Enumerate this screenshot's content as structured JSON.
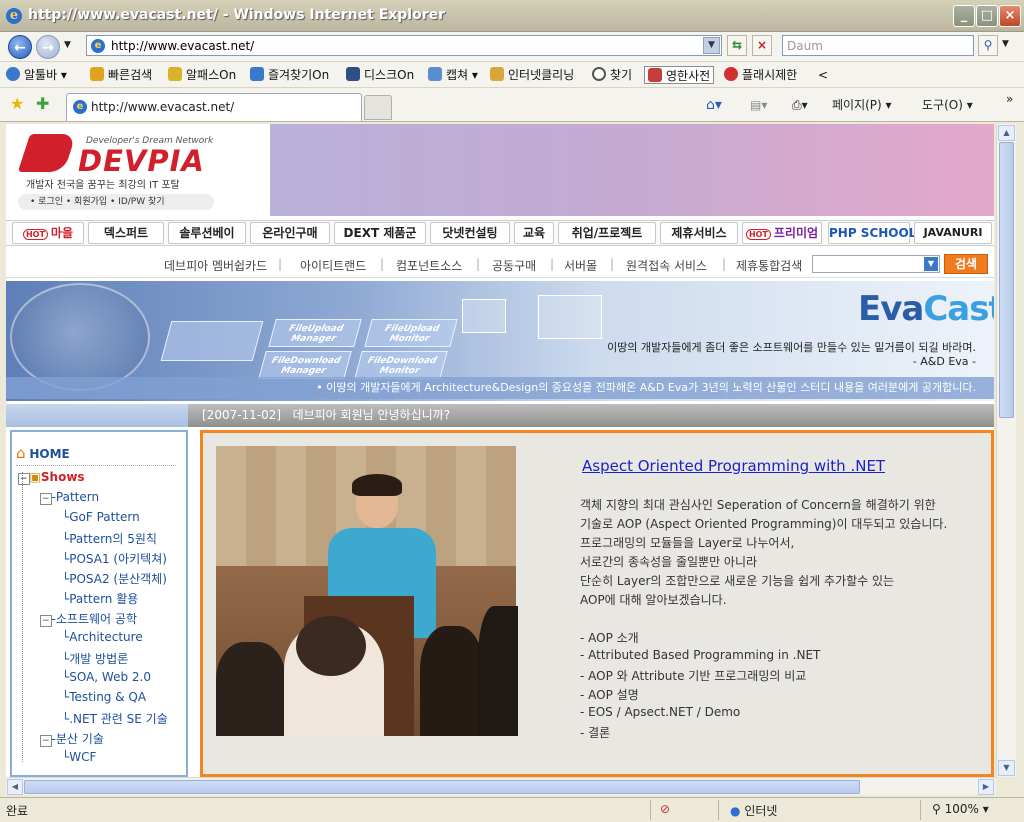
{
  "window": {
    "title": "http://www.evacast.net/ - Windows Internet Explorer"
  },
  "address": {
    "url": "http://www.evacast.net/",
    "search_placeholder": "Daum"
  },
  "toolbar": [
    "알툴바 ▾",
    "빠른검색",
    "알패스On",
    "즐겨찾기On",
    "디스크On",
    "캡쳐 ▾",
    "인터넷클리닝",
    "찾기",
    "영한사전",
    "플래시제한",
    "<"
  ],
  "tab": {
    "label": "http://www.evacast.net/"
  },
  "commands": {
    "page": "페이지(P) ▾",
    "tools": "도구(O) ▾",
    "more": "»"
  },
  "site": {
    "logo_tag": "Developer's Dream Network",
    "logo_text": "DEVPIA",
    "logo_sub": "개발자 천국을 꿈꾸는 최강의 IT 포탈",
    "logo_links": "• 로그인   • 회원가입   • ID/PW 찾기",
    "menu": [
      "마을",
      "덱스퍼트",
      "솔루션베이",
      "온라인구매",
      "DEXT 제품군",
      "닷넷컨설팅",
      "교육",
      "취업/프로젝트",
      "제휴서비스",
      "프리미엄",
      "PHP SCHOOL",
      "JAVANURI"
    ],
    "hot": "HOT",
    "submenu": [
      "데브피아 멤버쉽카드",
      "아이티트랜드",
      "컴포넌트소스",
      "공동구매",
      "서버몰",
      "원격접속 서비스",
      "제휴통합검색"
    ],
    "search_button": "검색"
  },
  "hero": {
    "title_eva": "Eva",
    "title_cast": "Cast",
    "cards": [
      "FileUpload Manager",
      "FileUpload Monitor",
      "FileDownload Manager",
      "FileDownload Monitor"
    ],
    "quote": "이땅의 개발자들에게 좀더 좋은 소프트웨어를 만들수 있는 밑거름이 되길 바라며.",
    "sign": "- A&D Eva -",
    "band": "• 이땅의 개발자들에게 Architecture&Design의 중요성을 전파해온 A&D Eva가 3년의 노력의 산물인 스터디 내용을 여러분에게 공개합니다."
  },
  "greeting": {
    "date": "[2007-11-02]",
    "text": "데브피아 회원님 안녕하십니까?"
  },
  "tree": {
    "home": "HOME",
    "shows": "Shows",
    "groups": [
      {
        "label": "Pattern",
        "items": [
          "GoF Pattern",
          "Pattern의 5원칙",
          "POSA1 (아키텍쳐)",
          "POSA2 (분산객체)",
          "Pattern 활용"
        ]
      },
      {
        "label": "소프트웨어 공학",
        "items": [
          "Architecture",
          "개발 방법론",
          "SOA, Web 2.0",
          "Testing & QA",
          ".NET 관련 SE 기술"
        ]
      },
      {
        "label": "분산 기술",
        "items": [
          "WCF"
        ]
      }
    ]
  },
  "article": {
    "title": "Aspect Oriented Programming with .NET",
    "body": [
      "객체 지향의 최대 관심사인 Seperation of Concern을 해결하기 위한",
      "기술로 AOP (Aspect Oriented Programming)이 대두되고 있습니다.",
      "프로그래밍의 모듈들을 Layer로 나누어서,",
      "서로간의 종속성을 줄일뿐만 아니라",
      "단순히 Layer의 조합만으로 새로운 기능을 쉽게 추가할수 있는",
      "AOP에 대해 알아보겠습니다."
    ],
    "bullets": [
      "- AOP 소개",
      "- Attributed Based Programming in .NET",
      "- AOP 와 Attribute 기반 프로그래밍의 비교",
      "- AOP 설명",
      "- EOS / Apsect.NET / Demo",
      "- 결론"
    ]
  },
  "status": {
    "left": "완료",
    "zone": "인터넷",
    "zoom": "100%"
  },
  "colors": {
    "brand_red": "#d2202a",
    "accent_orange": "#f0871e",
    "link_blue": "#1a22c9"
  }
}
